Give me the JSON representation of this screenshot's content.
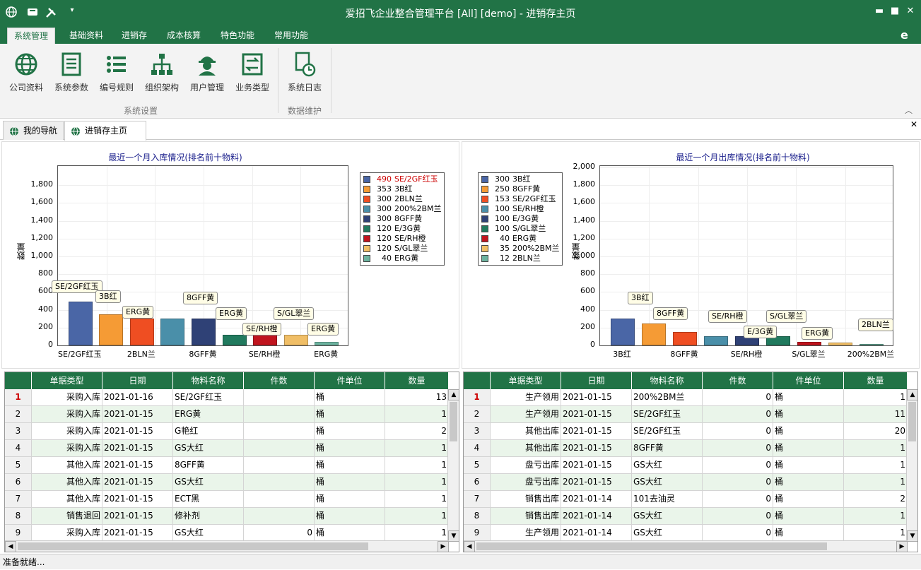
{
  "window": {
    "title": "爱招飞企业整合管理平台 [All] [demo] - 进销存主页",
    "minimize_icon": "minimize-icon",
    "maximize_icon": "maximize-icon",
    "close_icon": "close-icon"
  },
  "quick_access": [
    "globe-icon",
    "save-icon",
    "tools-icon",
    "dropdown-icon"
  ],
  "ribbon_tabs": [
    {
      "label": "系统管理",
      "active": true
    },
    {
      "label": "基础资料"
    },
    {
      "label": "进销存"
    },
    {
      "label": "成本核算"
    },
    {
      "label": "特色功能"
    },
    {
      "label": "常用功能"
    }
  ],
  "ribbon": {
    "buttons": [
      {
        "label": "公司资料",
        "icon": "globe-icon"
      },
      {
        "label": "系统参数",
        "icon": "list-document-icon"
      },
      {
        "label": "编号规则",
        "icon": "bullet-list-icon"
      },
      {
        "label": "组织架构",
        "icon": "org-chart-icon"
      },
      {
        "label": "用户管理",
        "icon": "user-icon"
      },
      {
        "label": "业务类型",
        "icon": "transfer-icon"
      },
      {
        "label": "系统日志",
        "icon": "clock-document-icon"
      }
    ],
    "groups": [
      "系统设置",
      "数据维护"
    ]
  },
  "doc_tabs": [
    {
      "label": "我的导航"
    },
    {
      "label": "进销存主页",
      "active": true
    }
  ],
  "chart_data": [
    {
      "type": "bar",
      "title": "最近一个月入库情况(排名前十物料)",
      "ylabel": "数量",
      "ylim": [
        0,
        2000
      ],
      "ticks": [
        "0",
        "200",
        "400",
        "600",
        "800",
        "1,000",
        "1,200",
        "1,400",
        "1,600",
        "1,800"
      ],
      "categories": [
        "SE/2GF红玉",
        "3B红",
        "ERG黄",
        "2BLN兰",
        "8GFF黄",
        "E/3G黄",
        "SE/RH橙",
        "S/GL翠兰",
        "ERG黄"
      ],
      "values": [
        490,
        353,
        300,
        300,
        300,
        120,
        120,
        120,
        40
      ],
      "colors": [
        "#4a66a6",
        "#f59b35",
        "#ef4e22",
        "#4a8fa9",
        "#2f4176",
        "#217a5e",
        "#c0141e",
        "#f0be66",
        "#6cb39f"
      ],
      "xticklabels": [
        "SE/2GF红玉",
        "2BLN兰",
        "8GFF黄",
        "SE/RH橙",
        "ERG黄"
      ],
      "legend": [
        {
          "value": "490",
          "name": "SE/2GF红玉",
          "highlight": true
        },
        {
          "value": "353",
          "name": "3B红"
        },
        {
          "value": "300",
          "name": "2BLN兰"
        },
        {
          "value": "300",
          "name": "200%2BM兰"
        },
        {
          "value": "300",
          "name": "8GFF黄"
        },
        {
          "value": "120",
          "name": "E/3G黄"
        },
        {
          "value": "120",
          "name": "SE/RH橙"
        },
        {
          "value": "120",
          "name": "S/GL翠兰"
        },
        {
          "value": "40",
          "name": "ERG黄"
        }
      ],
      "callouts": [
        "SE/2GF红玉",
        "3B红",
        "ERG黄",
        "8GFF黄",
        "ERG黄",
        "SE/RH橙",
        "S/GL翠兰",
        "ERG黄"
      ],
      "legend_position": "right"
    },
    {
      "type": "bar",
      "title": "最近一个月出库情况(排名前十物料)",
      "ylabel": "数量",
      "ylim": [
        0,
        2000
      ],
      "ticks": [
        "0",
        "200",
        "400",
        "600",
        "800",
        "1,000",
        "1,200",
        "1,400",
        "1,600",
        "1,800",
        "2,000"
      ],
      "categories": [
        "3B红",
        "8GFF黄",
        "SE/2GF红玉",
        "SE/RH橙",
        "E/3G黄",
        "S/GL翠兰",
        "ERG黄",
        "200%2BM兰",
        "2BLN兰"
      ],
      "values": [
        300,
        250,
        153,
        100,
        100,
        100,
        40,
        35,
        12
      ],
      "colors": [
        "#4a66a6",
        "#f59b35",
        "#ef4e22",
        "#4a8fa9",
        "#2f4176",
        "#217a5e",
        "#c0141e",
        "#f0be66",
        "#6cb39f"
      ],
      "xticklabels": [
        "3B红",
        "8GFF黄",
        "SE/RH橙",
        "S/GL翠兰",
        "200%2BM兰"
      ],
      "legend": [
        {
          "value": "300",
          "name": "3B红"
        },
        {
          "value": "250",
          "name": "8GFF黄"
        },
        {
          "value": "153",
          "name": "SE/2GF红玉"
        },
        {
          "value": "100",
          "name": "SE/RH橙"
        },
        {
          "value": "100",
          "name": "E/3G黄"
        },
        {
          "value": "100",
          "name": "S/GL翠兰"
        },
        {
          "value": "40",
          "name": "ERG黄"
        },
        {
          "value": "35",
          "name": "200%2BM兰"
        },
        {
          "value": "12",
          "name": "2BLN兰"
        }
      ],
      "callouts": [
        "3B红",
        "8GFF黄",
        "SE/RH橙",
        "E/3G黄",
        "S/GL翠兰",
        "ERG黄",
        "2BLN兰"
      ],
      "legend_position": "left"
    }
  ],
  "grid_headers": [
    "单据类型",
    "日期",
    "物料名称",
    "件数",
    "件单位",
    "数量"
  ],
  "grid_left": [
    [
      "1",
      "采购入库",
      "2021-01-16",
      "SE/2GF红玉",
      "",
      "桶",
      "13"
    ],
    [
      "2",
      "采购入库",
      "2021-01-15",
      "ERG黄",
      "",
      "桶",
      "1"
    ],
    [
      "3",
      "采购入库",
      "2021-01-15",
      "G艳红",
      "",
      "桶",
      "2"
    ],
    [
      "4",
      "采购入库",
      "2021-01-15",
      "GS大红",
      "",
      "桶",
      "1"
    ],
    [
      "5",
      "其他入库",
      "2021-01-15",
      "8GFF黄",
      "",
      "桶",
      "1"
    ],
    [
      "6",
      "其他入库",
      "2021-01-15",
      "GS大红",
      "",
      "桶",
      "1"
    ],
    [
      "7",
      "其他入库",
      "2021-01-15",
      "ECT黑",
      "",
      "桶",
      "1"
    ],
    [
      "8",
      "销售退回",
      "2021-01-15",
      "修补剂",
      "",
      "桶",
      "1"
    ],
    [
      "9",
      "采购入库",
      "2021-01-15",
      "GS大红",
      "0",
      "桶",
      "1"
    ]
  ],
  "grid_right": [
    [
      "1",
      "生产领用",
      "2021-01-15",
      "200%2BM兰",
      "0",
      "桶",
      "1"
    ],
    [
      "2",
      "生产领用",
      "2021-01-15",
      "SE/2GF红玉",
      "0",
      "桶",
      "11"
    ],
    [
      "3",
      "其他出库",
      "2021-01-15",
      "SE/2GF红玉",
      "0",
      "桶",
      "20"
    ],
    [
      "4",
      "其他出库",
      "2021-01-15",
      "8GFF黄",
      "0",
      "桶",
      "1"
    ],
    [
      "5",
      "盘亏出库",
      "2021-01-15",
      "GS大红",
      "0",
      "桶",
      "1"
    ],
    [
      "6",
      "盘亏出库",
      "2021-01-15",
      "GS大红",
      "0",
      "桶",
      "1"
    ],
    [
      "7",
      "销售出库",
      "2021-01-14",
      "101去油灵",
      "0",
      "桶",
      "2"
    ],
    [
      "8",
      "销售出库",
      "2021-01-14",
      "GS大红",
      "0",
      "桶",
      "1"
    ],
    [
      "9",
      "生产领用",
      "2021-01-14",
      "GS大红",
      "0",
      "桶",
      "1"
    ]
  ],
  "status": {
    "text": "准备就绪..."
  }
}
